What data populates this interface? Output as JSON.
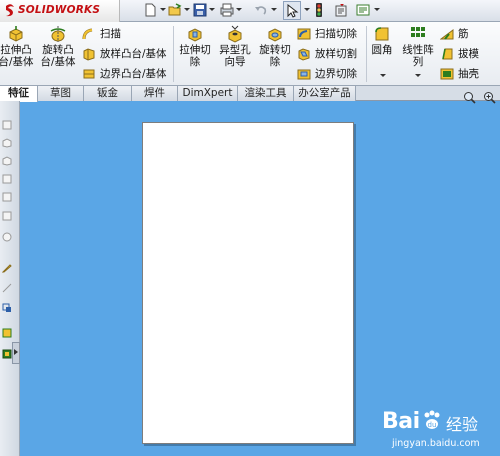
{
  "app": {
    "logo_text": "SOLIDWORKS"
  },
  "ribbon": {
    "extrude_boss": "拉伸凸\n台/基体",
    "revolve_boss": "旋转凸\n台/基体",
    "sweep": "扫描",
    "loft_boss": "放样凸台/基体",
    "boundary_boss": "边界凸台/基体",
    "extrude_cut": "拉伸切\n除",
    "hole_wizard": "异型孔\n向导",
    "revolve_cut": "旋转切\n除",
    "swept_cut": "扫描切除",
    "lofted_cut": "放样切割",
    "boundary_cut": "边界切除",
    "fillet": "圆角",
    "linear_pattern": "线性阵\n列",
    "rib": "筋",
    "draft": "拔模",
    "shell": "抽壳"
  },
  "tabs": [
    {
      "label": "特征"
    },
    {
      "label": "草图"
    },
    {
      "label": "钣金"
    },
    {
      "label": "焊件"
    },
    {
      "label": "DimXpert"
    },
    {
      "label": "渲染工具"
    },
    {
      "label": "办公室产品"
    }
  ],
  "watermark": {
    "brand_a": "Bai",
    "brand_b": "经验",
    "url": "jingyan.baidu.com"
  },
  "colors": {
    "viewport": "#5aa6e6",
    "brand_red": "#c40f12",
    "sheet": "#ffffff"
  }
}
